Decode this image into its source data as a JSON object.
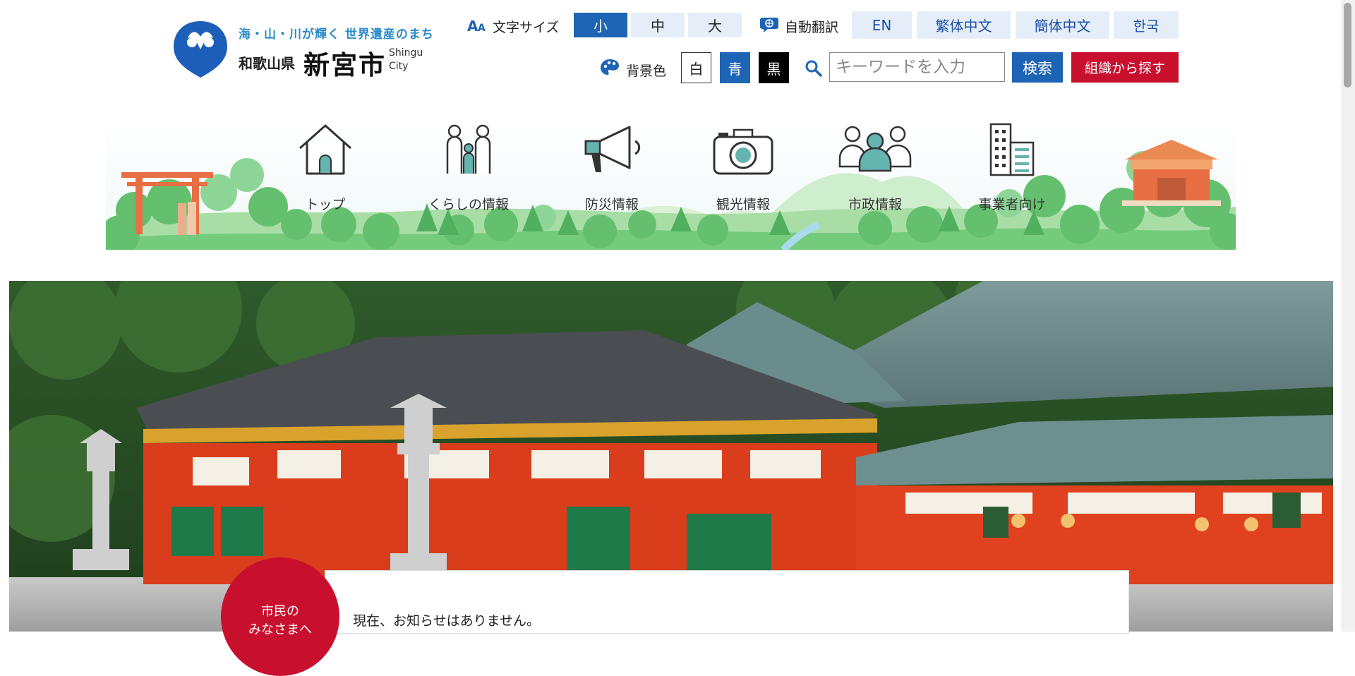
{
  "logo": {
    "tagline": "海・山・川が輝く 世界遺産のまち",
    "prefecture": "和歌山県",
    "city": "新宮市",
    "city_en_line1": "Shingu",
    "city_en_line2": "City"
  },
  "toolbar": {
    "font_size_label": "文字サイズ",
    "font_sizes": [
      "小",
      "中",
      "大"
    ],
    "auto_translate_label": "自動翻訳",
    "languages": [
      "EN",
      "繁体中文",
      "簡体中文",
      "한국"
    ],
    "bg_color_label": "背景色",
    "bg_options": [
      "白",
      "青",
      "黒"
    ],
    "search_placeholder": "キーワードを入力",
    "search_button": "検索",
    "org_button": "組織から探す"
  },
  "nav": {
    "items": [
      {
        "label": "トップ",
        "icon": "house-icon"
      },
      {
        "label": "くらしの情報",
        "icon": "family-icon"
      },
      {
        "label": "防災情報",
        "icon": "megaphone-icon"
      },
      {
        "label": "観光情報",
        "icon": "camera-icon"
      },
      {
        "label": "市政情報",
        "icon": "people-group-icon"
      },
      {
        "label": "事業者向け",
        "icon": "buildings-icon"
      }
    ]
  },
  "notice": {
    "circle_line1": "市民の",
    "circle_line2": "みなさまへ",
    "text": "現在、お知らせはありません。"
  },
  "colors": {
    "primary_blue": "#1e64b4",
    "accent_red": "#c8102e",
    "light_blue_bg": "#e5eef8"
  }
}
